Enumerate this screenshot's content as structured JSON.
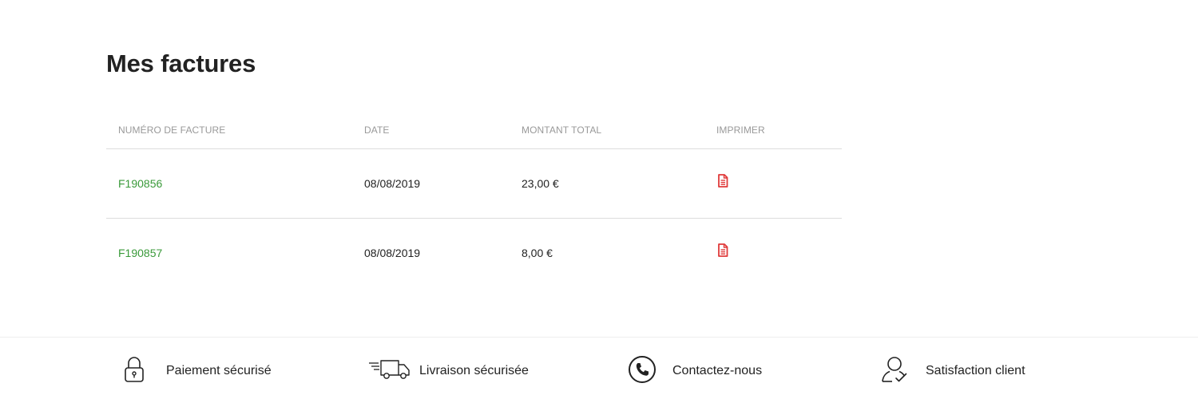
{
  "page": {
    "title": "Mes factures"
  },
  "table": {
    "headers": [
      "NUMÉRO DE FACTURE",
      "DATE",
      "MONTANT TOTAL",
      "IMPRIMER"
    ],
    "rows": [
      {
        "invoice_number": "F190856",
        "date": "08/08/2019",
        "total": "23,00 €",
        "print_icon": "document-icon"
      },
      {
        "invoice_number": "F190857",
        "date": "08/08/2019",
        "total": "8,00 €",
        "print_icon": "document-icon"
      }
    ]
  },
  "footer": {
    "features": [
      {
        "label": "Paiement sécurisé",
        "icon": "padlock-icon"
      },
      {
        "label": "Livraison sécurisée",
        "icon": "delivery-truck-icon"
      },
      {
        "label": "Contactez-nous",
        "icon": "phone-icon"
      },
      {
        "label": "Satisfaction client",
        "icon": "user-check-icon"
      }
    ]
  },
  "colors": {
    "invoice_link": "#3a9a3a",
    "print_icon": "#e03a3a",
    "header_text": "#999999",
    "divider": "#dddddd"
  }
}
